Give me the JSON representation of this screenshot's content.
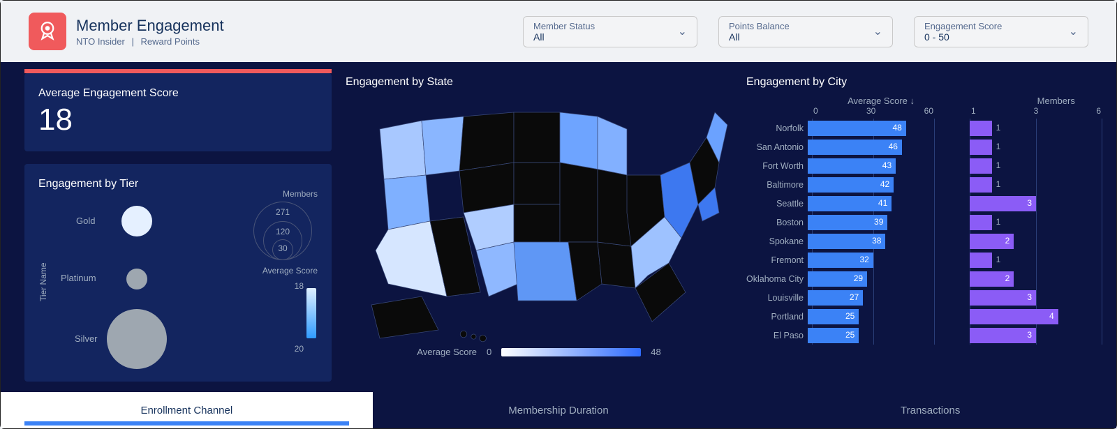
{
  "header": {
    "title": "Member Engagement",
    "subtitle_a": "NTO Insider",
    "subtitle_b": "Reward Points"
  },
  "filters": [
    {
      "label": "Member Status",
      "value": "All"
    },
    {
      "label": "Points Balance",
      "value": "All"
    },
    {
      "label": "Engagement Score",
      "value": "0 - 50"
    }
  ],
  "kpi": {
    "label": "Average Engagement Score",
    "value": "18"
  },
  "tier": {
    "title": "Engagement by Tier",
    "axis_label": "Tier Name",
    "members_label": "Members",
    "avg_score_label": "Average Score",
    "rings": [
      "271",
      "120",
      "30"
    ],
    "gradient_top": "18",
    "gradient_bottom": "20",
    "tiers": {
      "gold": "Gold",
      "platinum": "Platinum",
      "silver": "Silver"
    }
  },
  "map": {
    "title": "Engagement by State",
    "legend_label": "Average Score",
    "legend_min": "0",
    "legend_max": "48"
  },
  "city": {
    "title": "Engagement by City",
    "header_score": "Average Score ↓",
    "header_members": "Members",
    "score_ticks": [
      "0",
      "30",
      "60"
    ],
    "member_ticks": [
      "1",
      "3",
      "6"
    ],
    "rows": [
      {
        "name": "Norfolk",
        "score": 48,
        "members": 1
      },
      {
        "name": "San Antonio",
        "score": 46,
        "members": 1
      },
      {
        "name": "Fort Worth",
        "score": 43,
        "members": 1
      },
      {
        "name": "Baltimore",
        "score": 42,
        "members": 1
      },
      {
        "name": "Seattle",
        "score": 41,
        "members": 3
      },
      {
        "name": "Boston",
        "score": 39,
        "members": 1
      },
      {
        "name": "Spokane",
        "score": 38,
        "members": 2
      },
      {
        "name": "Fremont",
        "score": 32,
        "members": 1
      },
      {
        "name": "Oklahoma City",
        "score": 29,
        "members": 2
      },
      {
        "name": "Louisville",
        "score": 27,
        "members": 3
      },
      {
        "name": "Portland",
        "score": 25,
        "members": 4
      },
      {
        "name": "El Paso",
        "score": 25,
        "members": 3
      }
    ],
    "score_max": 60,
    "members_max": 6
  },
  "tabs": {
    "enrollment": "Enrollment Channel",
    "membership": "Membership Duration",
    "transactions": "Transactions"
  },
  "chart_data": [
    {
      "type": "bar",
      "title": "Engagement by City – Average Score",
      "xlabel": "Average Score",
      "ylabel": "City",
      "xlim": [
        0,
        60
      ],
      "ticks": [
        0,
        30,
        60
      ],
      "categories": [
        "Norfolk",
        "San Antonio",
        "Fort Worth",
        "Baltimore",
        "Seattle",
        "Boston",
        "Spokane",
        "Fremont",
        "Oklahoma City",
        "Louisville",
        "Portland",
        "El Paso"
      ],
      "values": [
        48,
        46,
        43,
        42,
        41,
        39,
        38,
        32,
        29,
        27,
        25,
        25
      ]
    },
    {
      "type": "bar",
      "title": "Engagement by City – Members",
      "xlabel": "Members",
      "ylabel": "City",
      "xlim": [
        1,
        6
      ],
      "ticks": [
        1,
        3,
        6
      ],
      "categories": [
        "Norfolk",
        "San Antonio",
        "Fort Worth",
        "Baltimore",
        "Seattle",
        "Boston",
        "Spokane",
        "Fremont",
        "Oklahoma City",
        "Louisville",
        "Portland",
        "El Paso"
      ],
      "values": [
        1,
        1,
        1,
        1,
        3,
        1,
        2,
        1,
        2,
        3,
        4,
        3
      ]
    },
    {
      "type": "scatter",
      "title": "Engagement by Tier",
      "xlabel": "Average Score",
      "ylabel": "Tier Name",
      "size_label": "Members",
      "size_levels": [
        271,
        120,
        30
      ],
      "color_range": [
        18,
        20
      ],
      "series": [
        {
          "name": "Gold",
          "tier": "Gold"
        },
        {
          "name": "Platinum",
          "tier": "Platinum"
        },
        {
          "name": "Silver",
          "tier": "Silver"
        }
      ]
    },
    {
      "type": "heatmap",
      "title": "Engagement by State",
      "value_label": "Average Score",
      "value_range": [
        0,
        48
      ]
    }
  ]
}
